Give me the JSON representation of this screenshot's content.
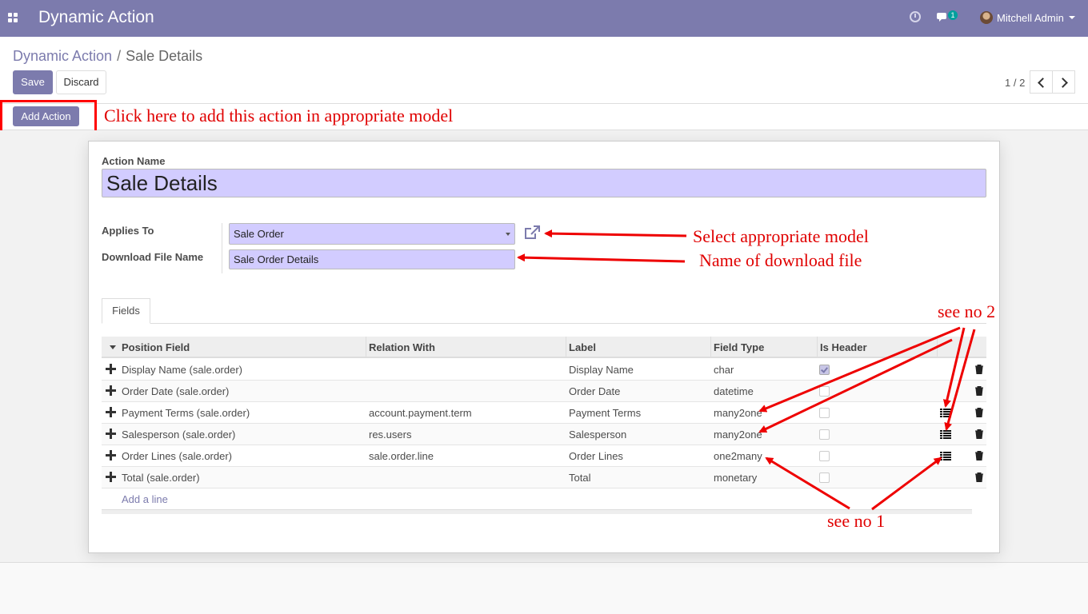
{
  "navbar": {
    "title": "Dynamic Action",
    "user_name": "Mitchell Admin",
    "chat_badge": "1"
  },
  "breadcrumb": {
    "parent": "Dynamic Action",
    "separator": "/",
    "current": "Sale Details"
  },
  "toolbar": {
    "save_label": "Save",
    "discard_label": "Discard",
    "add_action_label": "Add Action"
  },
  "pager": {
    "value": "1 / 2"
  },
  "form": {
    "action_name_label": "Action Name",
    "action_name_value": "Sale Details",
    "applies_to_label": "Applies To",
    "applies_to_value": "Sale Order",
    "download_file_label": "Download File Name",
    "download_file_value": "Sale Order Details"
  },
  "tabs": [
    {
      "label": "Fields"
    }
  ],
  "table": {
    "columns": [
      "Position Field",
      "Relation With",
      "Label",
      "Field Type",
      "Is Header"
    ],
    "rows": [
      {
        "position_field": "Display Name (sale.order)",
        "relation_with": "",
        "label": "Display Name",
        "field_type": "char",
        "is_header": true,
        "has_subfields": false
      },
      {
        "position_field": "Order Date (sale.order)",
        "relation_with": "",
        "label": "Order Date",
        "field_type": "datetime",
        "is_header": false,
        "has_subfields": false
      },
      {
        "position_field": "Payment Terms (sale.order)",
        "relation_with": "account.payment.term",
        "label": "Payment Terms",
        "field_type": "many2one",
        "is_header": false,
        "has_subfields": true
      },
      {
        "position_field": "Salesperson (sale.order)",
        "relation_with": "res.users",
        "label": "Salesperson",
        "field_type": "many2one",
        "is_header": false,
        "has_subfields": true
      },
      {
        "position_field": "Order Lines (sale.order)",
        "relation_with": "sale.order.line",
        "label": "Order Lines",
        "field_type": "one2many",
        "is_header": false,
        "has_subfields": true
      },
      {
        "position_field": "Total (sale.order)",
        "relation_with": "",
        "label": "Total",
        "field_type": "monetary",
        "is_header": false,
        "has_subfields": false
      }
    ],
    "add_line_label": "Add a line"
  },
  "annotations": {
    "add_action": "Click here to add this action in appropriate model",
    "select_model": "Select appropriate model",
    "download_name": "Name of download file",
    "see_no_2": "see no 2",
    "see_no_1": "see no 1"
  },
  "colors": {
    "brand": "#7c7bad",
    "input_bg": "#d2ccff",
    "annotation": "#e00000"
  }
}
